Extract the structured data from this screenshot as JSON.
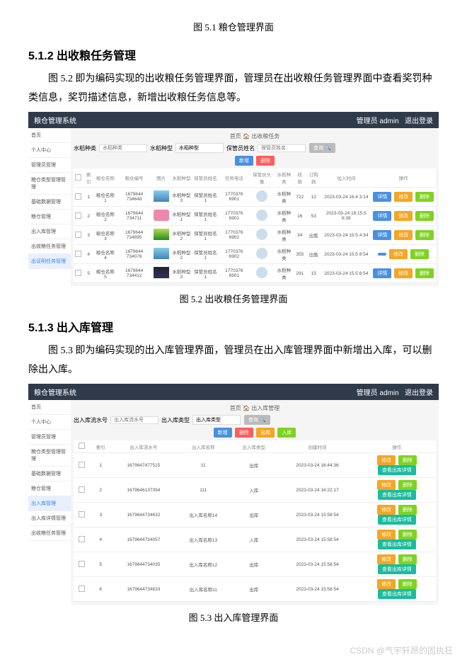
{
  "caption_51": "图 5.1 粮仓管理界面",
  "section_512": "5.1.2  出收粮任务管理",
  "para_512": "图 5.2 即为编码实现的出收粮任务管理界面，管理员在出收粮任务管理界面中查看奖罚种类信息，奖罚描述信息，新增出收粮任务信息等。",
  "caption_52": "图 5.2  出收粮任务管理界面",
  "section_513": "5.1.3  出入库管理",
  "para_513": "图 5.3 即为编码实现的出入库管理界面，管理员在出入库管理界面中新增出入库，可以删除出入库。",
  "caption_53": "图 5.3 出入库管理界面",
  "watermark": "CSDN @气宇轩昂的固执狂",
  "app": {
    "title": "粮仓管理系统",
    "user_label": "管理员 admin",
    "logout": "退出登录",
    "breadcrumb_home": "首页",
    "breadcrumb_task": "出收粮任务",
    "sidebar": {
      "items": [
        "首页",
        "个人中心",
        "管理员管理",
        "粮仓类型管理管理",
        "基础数据管理",
        "粮仓管理",
        "出入库管理",
        "出收粮任务管理",
        "出证明任务管理"
      ],
      "active_1": "出证明任务管理",
      "items2": [
        "首页",
        "个人中心",
        "管理员管理",
        "粮仓类型管理管理",
        "基础数据管理",
        "粮仓管理",
        "出入库管理",
        "出入库详情管理",
        "出收粮任务管理"
      ],
      "active_2": "出入库管理"
    },
    "search": {
      "labels": [
        "水稻种类",
        "水稻种型",
        "保管员姓名"
      ],
      "ph": [
        "水稻种类",
        "水稻种型",
        "保管员姓名"
      ],
      "btn_search": "查询 🔍",
      "btn_new": "新增",
      "btn_del": "删除"
    },
    "table1": {
      "headers": [
        "",
        "索引",
        "粮仓名称",
        "粮仓编号",
        "图片",
        "",
        "水稻种型",
        "保管员姓名",
        "任务电话",
        "",
        "保管员头像",
        "",
        "水稻种类",
        "结款",
        "订购款",
        "",
        "加入时间",
        "",
        "操作"
      ],
      "rows": [
        {
          "idx": "1",
          "name": "粮仓名称1",
          "code": "1679644 734648",
          "thumb": "blue",
          "type": "水稻种型3",
          "keeper": "保管员姓名1",
          "phone": "1770376 6901",
          "grain": "水稻种类",
          "a": "722",
          "b": "12",
          "time": "2023-03-24 16:4 3:14",
          "ops": [
            "详情",
            "修改",
            "删除"
          ]
        },
        {
          "idx": "2",
          "name": "粮仓名称2",
          "code": "1679644 734711",
          "thumb": "pink",
          "type": "水稻种型1",
          "keeper": "保管员姓名1",
          "phone": "1770376 6901",
          "grain": "水稻种类",
          "a": "16",
          "b": "53",
          "time": "2023-03-24 16:15:5 6:39",
          "ops": [
            "详情",
            "修改",
            "删除"
          ]
        },
        {
          "idx": "3",
          "name": "粮仓名称3",
          "code": "1679644 734895",
          "thumb": "green",
          "type": "水稻种型2",
          "keeper": "保管员姓名1",
          "phone": "1770376 6902",
          "grain": "水稻种类",
          "a": "34",
          "b": "出售",
          "time": "2023-03-24 15:5 4:34",
          "ops": [
            "详情",
            "修改",
            "删除"
          ]
        },
        {
          "idx": "4",
          "name": "粮仓名称4",
          "code": "1679644 734076",
          "thumb": "blue",
          "type": "水稻种型2",
          "keeper": "保管员姓名1",
          "phone": "1770376 6902",
          "grain": "水稻种类",
          "a": "355",
          "b": "出售",
          "time": "2023-03-24 15:5 8:54",
          "ops": [
            "",
            "修改",
            "删除"
          ]
        },
        {
          "idx": "5",
          "name": "粮仓名称5",
          "code": "1679644 734412",
          "thumb": "night",
          "type": "水稻种型3",
          "keeper": "保管员姓名1",
          "phone": "1770376 6901",
          "grain": "水稻种类",
          "a": "291",
          "b": "15",
          "time": "2023-03-24 15:5 8:54",
          "ops": [
            "详情",
            "修改",
            "删除"
          ]
        }
      ]
    },
    "search2": {
      "labels": [
        "出入库流水号",
        "出入库类型"
      ],
      "btn_search": "查询 🔍",
      "btn_new": "新增",
      "btn_del": "删除",
      "btn_out": "出库",
      "btn_in": "入库"
    },
    "table2": {
      "headers": [
        "",
        "索引",
        "出入库流水号",
        "出入库名称",
        "出入库类型",
        "创建时间",
        "操作"
      ],
      "btn_detail": "查看出库详情",
      "rows": [
        {
          "idx": "1",
          "code": "1679647477515",
          "name": "11",
          "type": "出库",
          "time": "2023-03-24 16:44:36",
          "ops": [
            "修改",
            "删除"
          ]
        },
        {
          "idx": "2",
          "code": "1679646137394",
          "name": "111",
          "type": "入库",
          "time": "2023-03-24 16:22:17",
          "ops": [
            "修改",
            "删除"
          ]
        },
        {
          "idx": "3",
          "code": "1679644734632",
          "name": "出入库名称14",
          "type": "出库",
          "time": "2023-03-24 15:58:54",
          "ops": [
            "修改",
            "删除"
          ]
        },
        {
          "idx": "4",
          "code": "1679644734057",
          "name": "出入库名称13",
          "type": "入库",
          "time": "2023-03-24 15:58:54",
          "ops": [
            "修改",
            "删除"
          ]
        },
        {
          "idx": "5",
          "code": "1679644734035",
          "name": "出入库名称12",
          "type": "出库",
          "time": "2023-03-24 15:58:54",
          "ops": [
            "修改",
            "删除"
          ]
        },
        {
          "idx": "6",
          "code": "1679644734633",
          "name": "出入库名称11",
          "type": "出库",
          "time": "2023-03-24 15:58:54",
          "ops": [
            "修改",
            "删除"
          ]
        }
      ]
    }
  }
}
